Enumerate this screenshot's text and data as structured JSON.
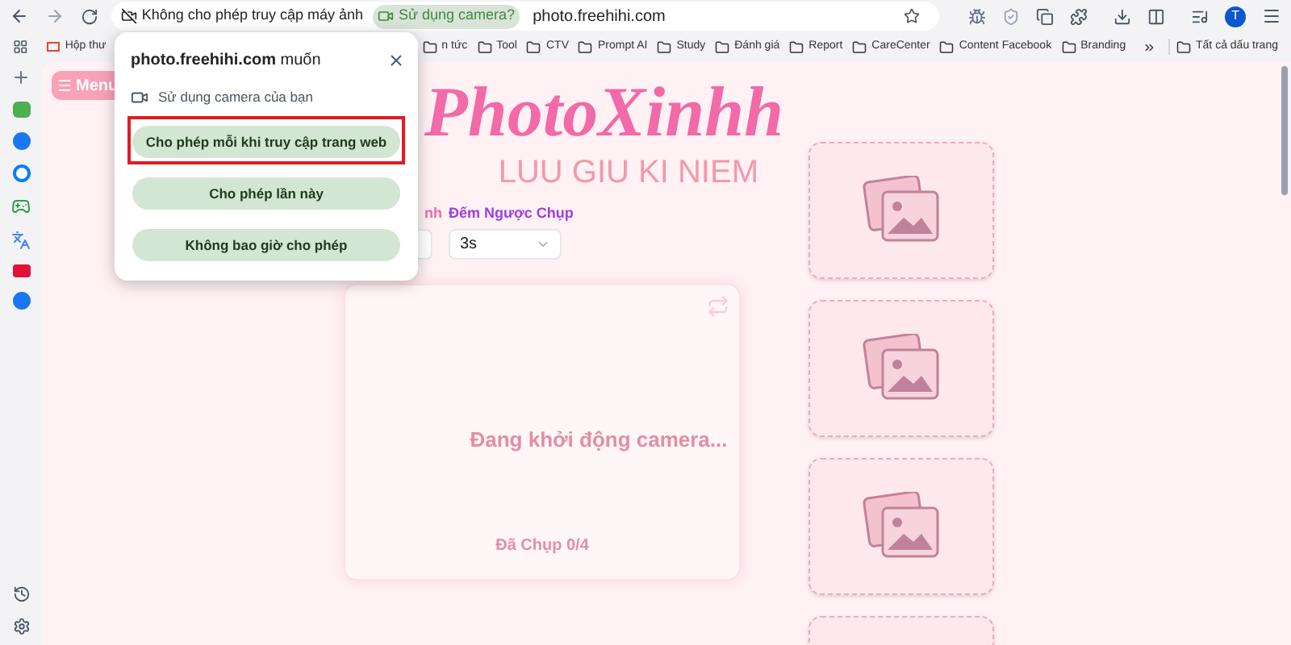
{
  "toolbar": {
    "permission_chip": "Không cho phép truy cập máy ảnh",
    "camera_chip": "Sử dụng camera?",
    "url": "photo.freehihi.com",
    "avatar": "T"
  },
  "bookmarks": [
    {
      "label": "Hộp thư",
      "kind": "gmail"
    },
    {
      "label": "n tức",
      "kind": "folder"
    },
    {
      "label": "Tool",
      "kind": "folder"
    },
    {
      "label": "CTV",
      "kind": "folder"
    },
    {
      "label": "Prompt AI",
      "kind": "folder"
    },
    {
      "label": "Study",
      "kind": "folder"
    },
    {
      "label": "Đánh giá",
      "kind": "folder"
    },
    {
      "label": "Report",
      "kind": "folder"
    },
    {
      "label": "CareCenter",
      "kind": "folder"
    },
    {
      "label": "Content Facebook",
      "kind": "folder"
    },
    {
      "label": "Branding",
      "kind": "folder"
    }
  ],
  "all_bookmarks": "Tất cả dấu trang",
  "page": {
    "menu_button": "Menu",
    "title": "PhotoXinhh",
    "subtitle": "LUU GIU KI NIEM",
    "layout_label": "nh",
    "countdown_label": "Đếm Ngược Chụp",
    "countdown_value": "3s",
    "camera_status": "Đang khởi động camera...",
    "shot_count": "Đã Chụp 0/4"
  },
  "permission_popup": {
    "site": "photo.freehihi.com",
    "verb": "muốn",
    "request": "Sử dụng camera của bạn",
    "buttons": [
      {
        "label": "Cho phép mỗi khi truy cập trang web",
        "highlighted": true
      },
      {
        "label": "Cho phép lần này",
        "highlighted": false
      },
      {
        "label": "Không bao giờ cho phép",
        "highlighted": false
      }
    ]
  }
}
